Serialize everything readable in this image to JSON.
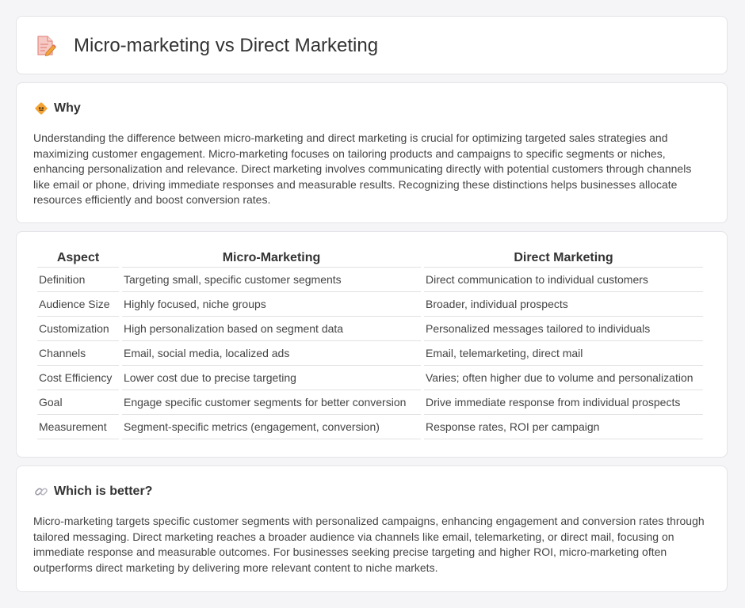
{
  "header": {
    "title": "Micro-marketing vs Direct Marketing",
    "icon": "document-pencil-icon"
  },
  "why": {
    "icon": "diamond-icon",
    "title": "Why",
    "text": "Understanding the difference between micro-marketing and direct marketing is crucial for optimizing targeted sales strategies and maximizing customer engagement. Micro-marketing focuses on tailoring products and campaigns to specific segments or niches, enhancing personalization and relevance. Direct marketing involves communicating directly with potential customers through channels like email or phone, driving immediate responses and measurable results. Recognizing these distinctions helps businesses allocate resources efficiently and boost conversion rates."
  },
  "table": {
    "headers": [
      "Aspect",
      "Micro-Marketing",
      "Direct Marketing"
    ],
    "rows": [
      [
        "Definition",
        "Targeting small, specific customer segments",
        "Direct communication to individual customers"
      ],
      [
        "Audience Size",
        "Highly focused, niche groups",
        "Broader, individual prospects"
      ],
      [
        "Customization",
        "High personalization based on segment data",
        "Personalized messages tailored to individuals"
      ],
      [
        "Channels",
        "Email, social media, localized ads",
        "Email, telemarketing, direct mail"
      ],
      [
        "Cost Efficiency",
        "Lower cost due to precise targeting",
        "Varies; often higher due to volume and personalization"
      ],
      [
        "Goal",
        "Engage specific customer segments for better conversion",
        "Drive immediate response from individual prospects"
      ],
      [
        "Measurement",
        "Segment-specific metrics (engagement, conversion)",
        "Response rates, ROI per campaign"
      ]
    ]
  },
  "better": {
    "icon": "link-icon",
    "title": "Which is better?",
    "text": "Micro-marketing targets specific customer segments with personalized campaigns, enhancing engagement and conversion rates through tailored messaging. Direct marketing reaches a broader audience via channels like email, telemarketing, or direct mail, focusing on immediate response and measurable outcomes. For businesses seeking precise targeting and higher ROI, micro-marketing often outperforms direct marketing by delivering more relevant content to niche markets."
  },
  "colors": {
    "background": "#f5f5f7",
    "card": "#ffffff",
    "border": "#e4e4e8",
    "accent_orange": "#f0a030",
    "icon_pink": "#e8807a"
  }
}
